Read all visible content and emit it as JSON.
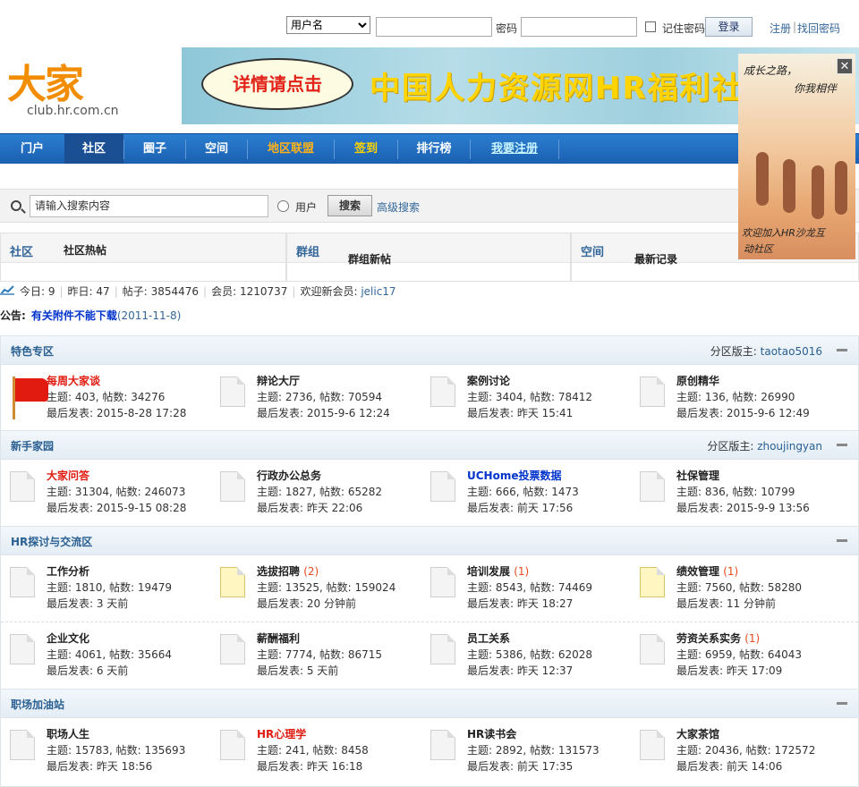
{
  "login": {
    "select_value": "用户名",
    "password_label": "密码",
    "remember_label": "记住密码",
    "login_button": "登录",
    "register_link": "注册",
    "divider": "|",
    "forgot_link": "找回密码"
  },
  "logo": {
    "mark": "大家",
    "url": "club.hr.com.cn"
  },
  "banner": {
    "cloud_text": "详情请点击",
    "slogan": "中国人力资源网HR福利社上线"
  },
  "side_ad": {
    "line1": "成长之路，",
    "line2": "你我相伴",
    "line3": "欢迎加入HR沙龙互",
    "line4": "动社区",
    "close": "✕"
  },
  "nav": {
    "items": [
      {
        "label": "门户"
      },
      {
        "label": "社区"
      },
      {
        "label": "圈子"
      },
      {
        "label": "空间"
      },
      {
        "label": "地区联盟"
      },
      {
        "label": "签到"
      },
      {
        "label": "排行榜"
      },
      {
        "label": "我要注册"
      }
    ]
  },
  "search": {
    "placeholder": "请输入搜索内容",
    "radio_label": "用户",
    "button": "搜索",
    "advanced": "高级搜索"
  },
  "hot": {
    "community_tab": "社区",
    "community_sub": "社区热帖",
    "group_tab": "群组",
    "group_sub": "群组新帖",
    "space_tab": "空间",
    "space_sub": "最新记录"
  },
  "stats": {
    "today": "今日: 9",
    "yesterday": "昨日: 47",
    "posts": "帖子: 3854476",
    "members": "会员: 1210737",
    "welcome": "欢迎新会员: ",
    "new_member": "jelic17"
  },
  "notice": {
    "label": "公告:",
    "title": "有关附件不能下载",
    "date": "(2011-11-8)"
  },
  "categories": [
    {
      "name": "特色专区",
      "moderator_label": "分区版主: ",
      "moderator": "taotao5016",
      "rows": [
        [
          {
            "title": "每周大家谈",
            "topics": "主题: 403, 帖数: 34276",
            "last": "最后发表: 2015-8-28 17:28"
          },
          {
            "title": "辩论大厅",
            "topics": "主题: 2736, 帖数: 70594",
            "last": "最后发表: 2015-9-6 12:24"
          },
          {
            "title": "案例讨论",
            "topics": "主题: 3404, 帖数: 78412",
            "last": "最后发表: 昨天 15:41"
          },
          {
            "title": "原创精华",
            "topics": "主题: 136, 帖数: 26990",
            "last": "最后发表: 2015-9-6 12:49"
          }
        ]
      ]
    },
    {
      "name": "新手家园",
      "moderator_label": "分区版主: ",
      "moderator": "zhoujingyan",
      "rows": [
        [
          {
            "title": "大家问答",
            "topics": "主题: 31304, 帖数: 246073",
            "last": "最后发表: 2015-9-15 08:28"
          },
          {
            "title": "行政办公总务",
            "topics": "主题: 1827, 帖数: 65282",
            "last": "最后发表: 昨天 22:06"
          },
          {
            "title": "UCHome投票数据",
            "topics": "主题: 666, 帖数: 1473",
            "last": "最后发表: 前天 17:56"
          },
          {
            "title": "社保管理",
            "topics": "主题: 836, 帖数: 10799",
            "last": "最后发表: 2015-9-9 13:56"
          }
        ]
      ]
    },
    {
      "name": "HR探讨与交流区",
      "rows": [
        [
          {
            "title": "工作分析",
            "topics": "主题: 1810, 帖数: 19479",
            "last": "最后发表: 3 天前"
          },
          {
            "title": "选拔招聘",
            "count": "(2)",
            "topics": "主题: 13525, 帖数: 159024",
            "last": "最后发表: 20 分钟前"
          },
          {
            "title": "培训发展",
            "count": "(1)",
            "topics": "主题: 8543, 帖数: 74469",
            "last": "最后发表: 昨天 18:27"
          },
          {
            "title": "绩效管理",
            "count": "(1)",
            "topics": "主题: 7560, 帖数: 58280",
            "last": "最后发表: 11 分钟前"
          }
        ],
        [
          {
            "title": "企业文化",
            "topics": "主题: 4061, 帖数: 35664",
            "last": "最后发表: 6 天前"
          },
          {
            "title": "薪酬福利",
            "topics": "主题: 7774, 帖数: 86715",
            "last": "最后发表: 5 天前"
          },
          {
            "title": "员工关系",
            "topics": "主题: 5386, 帖数: 62028",
            "last": "最后发表: 昨天 12:37"
          },
          {
            "title": "劳资关系实务",
            "count": "(1)",
            "topics": "主题: 6959, 帖数: 64043",
            "last": "最后发表: 昨天 17:09"
          }
        ]
      ]
    },
    {
      "name": "职场加油站",
      "rows": [
        [
          {
            "title": "职场人生",
            "topics": "主题: 15783, 帖数: 135693",
            "last": "最后发表: 昨天 18:56"
          },
          {
            "title": "HR心理学",
            "topics": "主题: 241, 帖数: 8458",
            "last": "最后发表: 昨天 16:18"
          },
          {
            "title": "HR读书会",
            "topics": "主题: 2892, 帖数: 131573",
            "last": "最后发表: 前天 17:35"
          },
          {
            "title": "大家茶馆",
            "topics": "主题: 20436, 帖数: 172572",
            "last": "最后发表: 前天 14:06"
          }
        ]
      ]
    }
  ]
}
